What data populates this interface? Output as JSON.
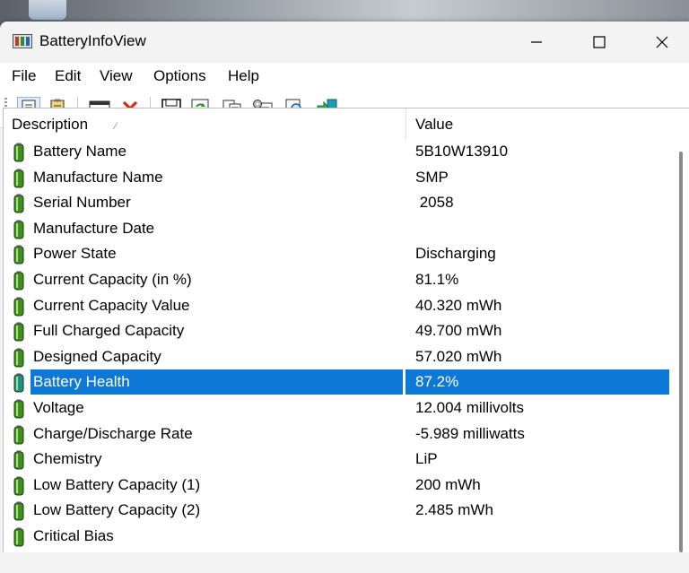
{
  "window": {
    "title": "BatteryInfoView"
  },
  "menu": [
    "File",
    "Edit",
    "View",
    "Options",
    "Help"
  ],
  "toolbar_icons": [
    "html-report-icon",
    "text-report-icon",
    "properties-window-icon",
    "delete-icon",
    "save-icon",
    "refresh-icon",
    "copy-icon",
    "properties-icon",
    "find-icon",
    "exit-icon"
  ],
  "columns": {
    "description": "Description",
    "value": "Value"
  },
  "rows": [
    {
      "description": "Battery Name",
      "value": "5B10W13910"
    },
    {
      "description": "Manufacture Name",
      "value": "SMP"
    },
    {
      "description": "Serial Number",
      "value": " 2058"
    },
    {
      "description": "Manufacture Date",
      "value": ""
    },
    {
      "description": "Power State",
      "value": "Discharging"
    },
    {
      "description": "Current Capacity (in %)",
      "value": "81.1%"
    },
    {
      "description": "Current Capacity Value",
      "value": "40.320 mWh"
    },
    {
      "description": "Full Charged Capacity",
      "value": "49.700 mWh"
    },
    {
      "description": "Designed Capacity",
      "value": "57.020 mWh"
    },
    {
      "description": "Battery Health",
      "value": "87.2%",
      "selected": true
    },
    {
      "description": "Voltage",
      "value": "12.004 millivolts"
    },
    {
      "description": "Charge/Discharge Rate",
      "value": "-5.989 milliwatts"
    },
    {
      "description": "Chemistry",
      "value": "LiP"
    },
    {
      "description": "Low Battery Capacity (1)",
      "value": "200 mWh"
    },
    {
      "description": "Low Battery Capacity (2)",
      "value": "2.485 mWh"
    },
    {
      "description": "Critical Bias",
      "value": ""
    }
  ],
  "colors": {
    "selection": "#0e78d7",
    "battery_green": "#3f8f1f"
  }
}
